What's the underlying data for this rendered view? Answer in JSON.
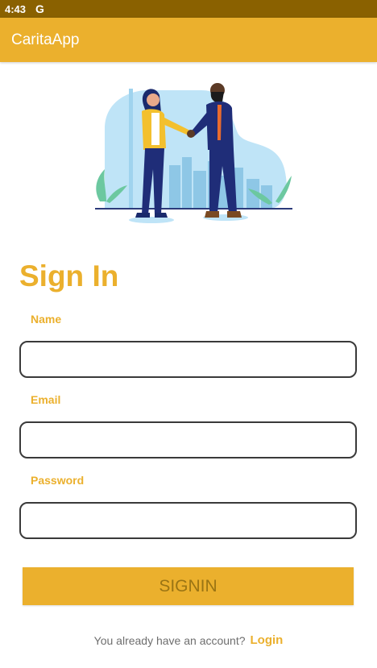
{
  "status_bar": {
    "time": "4:43",
    "google_icon": "G"
  },
  "app_bar": {
    "title": "CaritaApp"
  },
  "illustration": {
    "name": "handshake-business-illustration"
  },
  "form": {
    "title": "Sign In",
    "name_label": "Name",
    "name_value": "",
    "email_label": "Email",
    "email_value": "",
    "password_label": "Password",
    "password_value": "",
    "submit_label": "SIGNIN"
  },
  "footer": {
    "prompt": "You already have an account?",
    "login_label": "Login"
  },
  "colors": {
    "accent": "#ebb02d",
    "status_bar": "#8a6100",
    "input_border": "#3a3a3a"
  }
}
